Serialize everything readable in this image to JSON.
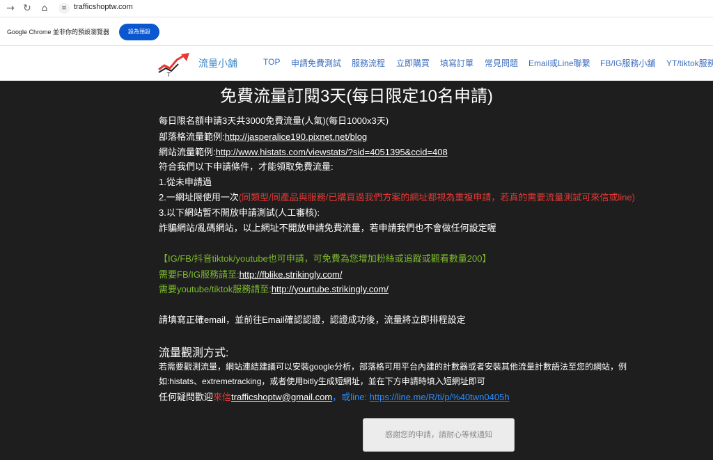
{
  "browser": {
    "url": "trafficshoptw.com",
    "info_message": "Google Chrome 並非你的預設瀏覽器",
    "default_button": "設為預設"
  },
  "site": {
    "logo_text": "流量小舖",
    "menu": [
      "TOP",
      "申請免費測試",
      "服務流程",
      "立即購買",
      "填寫訂單",
      "常見問題",
      "Email或Line聯繫",
      "FB/IG服務小舖",
      "YT/tiktok服務"
    ]
  },
  "main": {
    "title": "免費流量訂閱3天(每日限定10名申請)",
    "lines": [
      "每日限名額申請3天共3000免費流量(人氣)(每日1000x3天)",
      "部落格流量範例:",
      "http://jasperalice190.pixnet.net/blog",
      "網站流量範例:",
      "http://www.histats.com/viewstats/?sid=4051395&ccid=408",
      "符合我們以下申請條件，才能領取免費流量:",
      "1.從未申請過",
      "2.一網址限使用一次",
      "(同類型/同產品與服務/已購買過我們方案的網址都視為重複申請，若真的需要流量測試可來信或line)",
      "3.以下網站暫不開放申請測試(人工審核):",
      "詐騙網站/亂碼網站，以上網址不開放申請免費流量，若申請我們也不會做任何設定喔",
      "【IG/FB/抖音tiktok/youtube也可申請，可免費為您增加粉絲或追蹤或觀看數量200】",
      "需要FB/IG服務請至:",
      "http://fblike.strikingly.com/",
      "需要youtube/tiktok服務請至:",
      "http://yourtube.strikingly.com/",
      "請填寫正確email，並前往Email確認認證，認證成功後，流量將立即排程設定"
    ],
    "observe_title": "流量觀測方式:",
    "observe_lines": [
      "若需要觀測流量，網站連結建議可以安裝google分析，部落格可用平台內建的計數器或者安裝其他流量計數語法至您的網站，例",
      "如:histats、extremetracking，或者使用bitly生成短網址，並在下方申請時填入短網址即可"
    ],
    "contact_prefix": "任何疑問歡迎",
    "contact_red": "來信",
    "contact_email": "trafficshoptw@gmail.com",
    "contact_blue": "，或line: ",
    "contact_line_url": "https://line.me/R/ti/p/%40twn0405h",
    "submit_button": "感謝您的申請，請耐心等候通知"
  },
  "colors": {
    "background": "#1e1e1e",
    "red": "#e53935",
    "green": "#7dbb2d",
    "blue": "#2a8cff",
    "chrome_button": "#0b57d0",
    "menu": "#3f6fbf"
  },
  "icons": [
    "forward-arrow-icon",
    "reload-icon",
    "home-icon",
    "site-info-icon",
    "logo-icon"
  ]
}
